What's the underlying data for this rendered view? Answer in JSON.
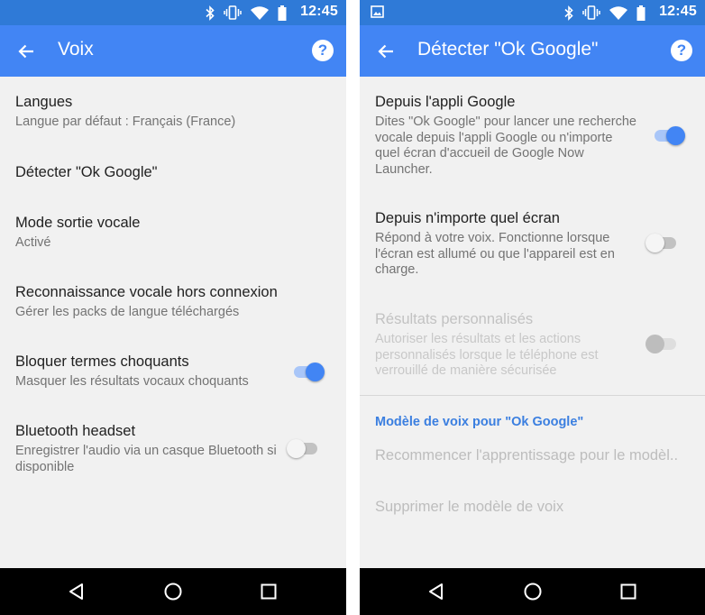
{
  "status_bar": {
    "time": "12:45"
  },
  "left": {
    "title": "Voix",
    "items": [
      {
        "title": "Langues",
        "subtitle": "Langue par défaut : Français (France)"
      },
      {
        "title": "Détecter \"Ok Google\""
      },
      {
        "title": "Mode sortie vocale",
        "subtitle": "Activé"
      },
      {
        "title": "Reconnaissance vocale hors connexion",
        "subtitle": "Gérer les packs de langue téléchargés"
      },
      {
        "title": "Bloquer termes choquants",
        "subtitle": "Masquer les résultats vocaux choquants",
        "toggle": "on"
      },
      {
        "title": "Bluetooth headset",
        "subtitle": "Enregistrer l'audio via un casque Bluetooth si disponible",
        "toggle": "off"
      }
    ]
  },
  "right": {
    "title": "Détecter \"Ok Google\"",
    "items": [
      {
        "title": "Depuis l'appli Google",
        "subtitle": "Dites \"Ok Google\" pour lancer une recherche vocale depuis l'appli Google ou n'importe quel écran d'accueil de Google Now Launcher.",
        "toggle": "on"
      },
      {
        "title": "Depuis n'importe quel écran",
        "subtitle": "Répond à votre voix. Fonctionne lorsque l'écran est allumé ou que l'appareil est en charge.",
        "toggle": "off"
      },
      {
        "title": "Résultats personnalisés",
        "subtitle": "Autoriser les résultats et les actions personnalisés lorsque le téléphone est verrouillé de manière sécurisée",
        "toggle": "disabled"
      }
    ],
    "section_header": "Modèle de voix pour \"Ok Google\"",
    "section_items": [
      "Recommencer l'apprentissage pour le modèl..",
      "Supprimer le modèle de voix"
    ]
  },
  "icons": {
    "status": [
      "bluetooth-icon",
      "vibrate-icon",
      "wifi-icon",
      "battery-icon"
    ],
    "navbar": [
      "nav-back-icon",
      "nav-home-icon",
      "nav-recents-icon"
    ]
  },
  "colors": {
    "status_bar": "#2f7ad7",
    "app_bar": "#4285f4",
    "accent": "#4285f4",
    "section_header": "#3b7fe0",
    "background": "#f1f1f1",
    "nav_bar": "#000000"
  }
}
